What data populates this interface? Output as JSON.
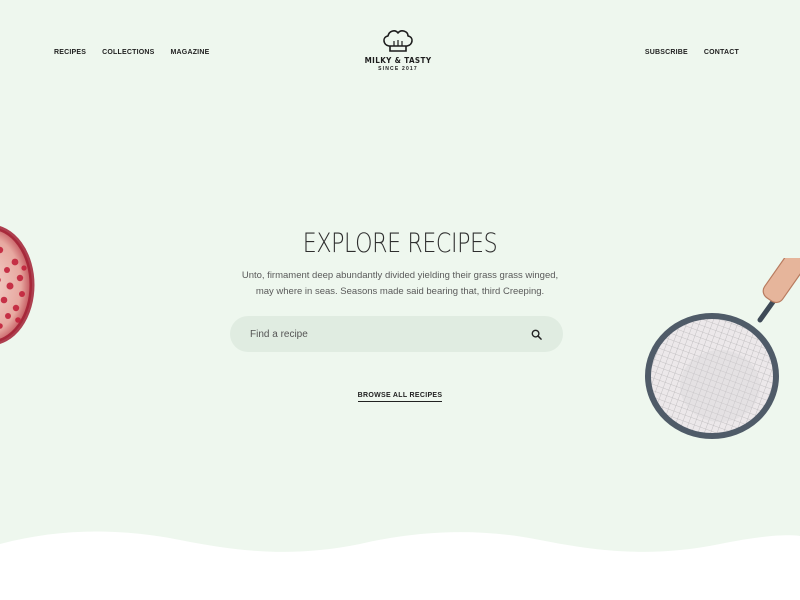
{
  "nav": {
    "left": [
      {
        "label": "RECIPES"
      },
      {
        "label": "COLLECTIONS"
      },
      {
        "label": "MAGAZINE"
      }
    ],
    "right": [
      {
        "label": "SUBSCRIBE"
      },
      {
        "label": "CONTACT"
      }
    ]
  },
  "logo": {
    "name": "MILKY & TASTY",
    "since": "SINCE 2017",
    "icon": "chef-hat-icon"
  },
  "hero": {
    "title": "EXPLORE RECIPES",
    "subtitle_line1": "Unto, firmament deep abundantly divided yielding their grass grass winged,",
    "subtitle_line2": "may where in seas. Seasons made said bearing that, third Creeping.",
    "search_placeholder": "Find a recipe",
    "search_icon": "search-icon",
    "browse_label": "BROWSE ALL RECIPES"
  },
  "colors": {
    "hero_bg": "#eef7ee",
    "search_bg": "#e0ece1",
    "text": "#2b2b2b"
  },
  "illustrations": [
    "pomegranate-illustration",
    "strainer-illustration"
  ]
}
